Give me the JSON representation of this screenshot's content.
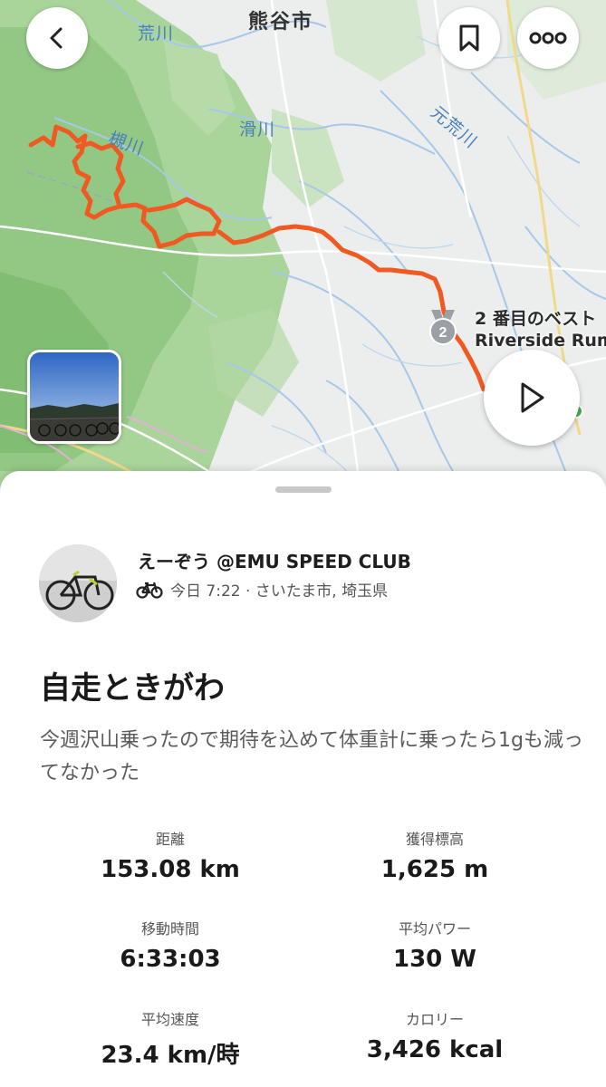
{
  "map": {
    "city_label": "熊谷市",
    "river_labels": [
      "荒川",
      "滑川",
      "元荒川",
      "槻川"
    ],
    "route_color": "#f05a22",
    "segment": {
      "rank": "2",
      "line1": "2 番目のベスト",
      "line2": "Riverside Rumb"
    }
  },
  "toolbar": {
    "back_icon": "chevron-left-icon",
    "save_icon": "bookmark-icon",
    "more_icon": "more-horizontal-icon",
    "play_icon": "play-icon"
  },
  "activity": {
    "athlete_name": "えーぞう @EMU SPEED CLUB",
    "activity_icon": "bike-icon",
    "meta": "今日 7:22 · さいたま市, 埼玉県",
    "title": "自走ときがわ",
    "description": "今週沢山乗ったので期待を込めて体重計に乗ったら1gも減ってなかった"
  },
  "stats": [
    {
      "label": "距離",
      "value": "153.08 km"
    },
    {
      "label": "獲得標高",
      "value": "1,625 m"
    },
    {
      "label": "移動時間",
      "value": "6:33:03"
    },
    {
      "label": "平均パワー",
      "value": "130 W"
    },
    {
      "label": "平均速度",
      "value": "23.4 km/時"
    },
    {
      "label": "カロリー",
      "value": "3,426 kcal"
    }
  ]
}
